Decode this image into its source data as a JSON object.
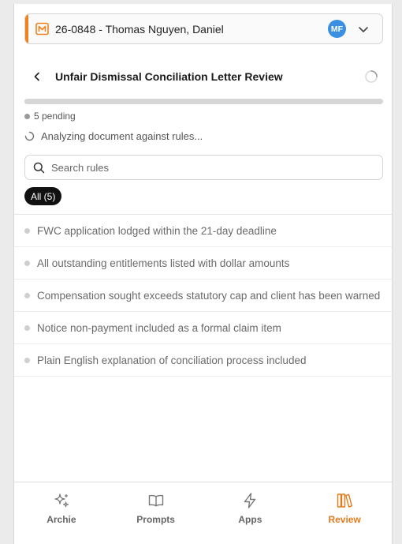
{
  "matter": {
    "label": "26-0848 - Thomas Nguyen, Daniel",
    "avatar_initials": "MF",
    "accent_color": "#f0821e",
    "avatar_color": "#3b8fe0"
  },
  "review": {
    "title": "Unfair Dismissal Conciliation Letter Review",
    "progress_fraction": 0.0,
    "pending_text": "5 pending",
    "status_text": "Analyzing document against rules..."
  },
  "search": {
    "placeholder": "Search rules"
  },
  "filter": {
    "all_label": "All (5)"
  },
  "rules": [
    {
      "text": "FWC application lodged within the 21-day deadline"
    },
    {
      "text": "All outstanding entitlements listed with dollar amounts"
    },
    {
      "text": "Compensation sought exceeds statutory cap and client has been warned"
    },
    {
      "text": "Notice non-payment included as a formal claim item"
    },
    {
      "text": "Plain English explanation of conciliation process included"
    }
  ],
  "nav": {
    "items": [
      {
        "label": "Archie",
        "icon": "sparkles-icon"
      },
      {
        "label": "Prompts",
        "icon": "book-open-icon"
      },
      {
        "label": "Apps",
        "icon": "lightning-icon"
      },
      {
        "label": "Review",
        "icon": "library-icon",
        "active": true
      }
    ],
    "active_color": "#e27a1c"
  }
}
